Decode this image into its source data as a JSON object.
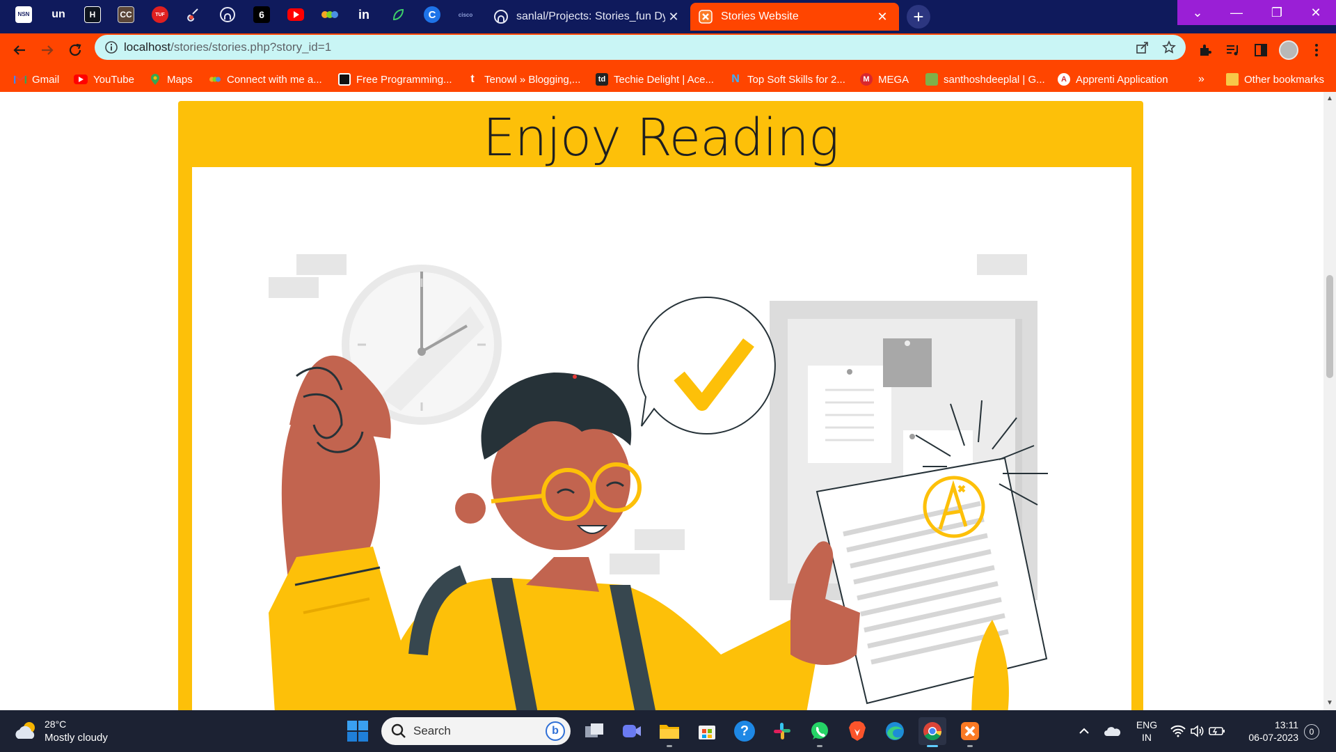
{
  "browser": {
    "pinned_tabs": [
      {
        "icon": "nsn-icon",
        "text": "NSN",
        "color": "#ffffff"
      },
      {
        "icon": "unacademy-icon",
        "text": "un",
        "color": "#2b3a8f"
      },
      {
        "icon": "hackerrank-icon",
        "text": "H",
        "color": "#0e141e"
      },
      {
        "icon": "codechef-icon",
        "text": "CC",
        "color": "#5b4638"
      },
      {
        "icon": "tuf-icon",
        "text": "TUF",
        "color": "#e02020"
      },
      {
        "icon": "guitar-icon",
        "text": "",
        "color": "#1b2466"
      },
      {
        "icon": "github-icon",
        "text": "",
        "color": "#1b2466"
      },
      {
        "icon": "github-dark-icon",
        "text": "",
        "color": "#000000"
      },
      {
        "icon": "youtube-icon",
        "text": "",
        "color": "#ff0000"
      },
      {
        "icon": "link-icon",
        "text": "",
        "color": "#1b2466"
      },
      {
        "icon": "linkedin-icon",
        "text": "in",
        "color": "#0a66c2"
      },
      {
        "icon": "leaf-icon",
        "text": "",
        "color": "#1b2466"
      },
      {
        "icon": "c-icon",
        "text": "C",
        "color": "#1e73e8"
      },
      {
        "icon": "cisco-icon",
        "text": "cisco",
        "color": "#1b2466"
      }
    ],
    "tabs": [
      {
        "title": "sanlal/Projects: Stories_fun Dynamic",
        "active": false
      },
      {
        "title": "Stories Website",
        "active": true
      }
    ],
    "url_host": "localhost",
    "url_path": "/stories/stories.php?story_id=1",
    "bookmarks": [
      {
        "label": "Gmail",
        "icon": "gmail-icon"
      },
      {
        "label": "YouTube",
        "icon": "youtube-icon"
      },
      {
        "label": "Maps",
        "icon": "maps-icon"
      },
      {
        "label": "Connect with me a...",
        "icon": "connect-icon"
      },
      {
        "label": "Free Programming...",
        "icon": "programming-icon"
      },
      {
        "label": "Tenowl » Blogging,...",
        "icon": "tenowl-icon"
      },
      {
        "label": "Techie Delight | Ace...",
        "icon": "techie-delight-icon"
      },
      {
        "label": "Top Soft Skills for 2...",
        "icon": "soft-skills-icon"
      },
      {
        "label": "MEGA",
        "icon": "mega-icon"
      },
      {
        "label": "santhoshdeeplal | G...",
        "icon": "santhosh-icon"
      },
      {
        "label": "Apprenti Application",
        "icon": "apprenti-icon"
      }
    ],
    "bookmarks_overflow": "»",
    "other_bookmarks": "Other bookmarks",
    "colors": {
      "tabstrip": "#0f1a5c",
      "accent": "#ff4500",
      "omnibox": "#c9f5f5",
      "window_controls": "#9a1fd6"
    }
  },
  "page": {
    "heading": "Enjoy Reading",
    "card_color": "#fdc009",
    "illustration": "student-celebrating-a-plus-grade-illustration"
  },
  "taskbar": {
    "weather_temp": "28°C",
    "weather_desc": "Mostly cloudy",
    "search_placeholder": "Search",
    "bing_label": "b",
    "apps": [
      {
        "name": "task-view",
        "active": false
      },
      {
        "name": "meet",
        "active": false
      },
      {
        "name": "file-explorer",
        "active": false
      },
      {
        "name": "microsoft-store",
        "active": false
      },
      {
        "name": "help",
        "active": false
      },
      {
        "name": "slack",
        "active": false
      },
      {
        "name": "whatsapp",
        "active": false
      },
      {
        "name": "brave",
        "active": false
      },
      {
        "name": "edge",
        "active": false
      },
      {
        "name": "chrome",
        "active": true
      },
      {
        "name": "xampp",
        "active": false
      }
    ],
    "lang_line1": "ENG",
    "lang_line2": "IN",
    "time": "13:11",
    "date": "06-07-2023",
    "notifications": "0"
  }
}
